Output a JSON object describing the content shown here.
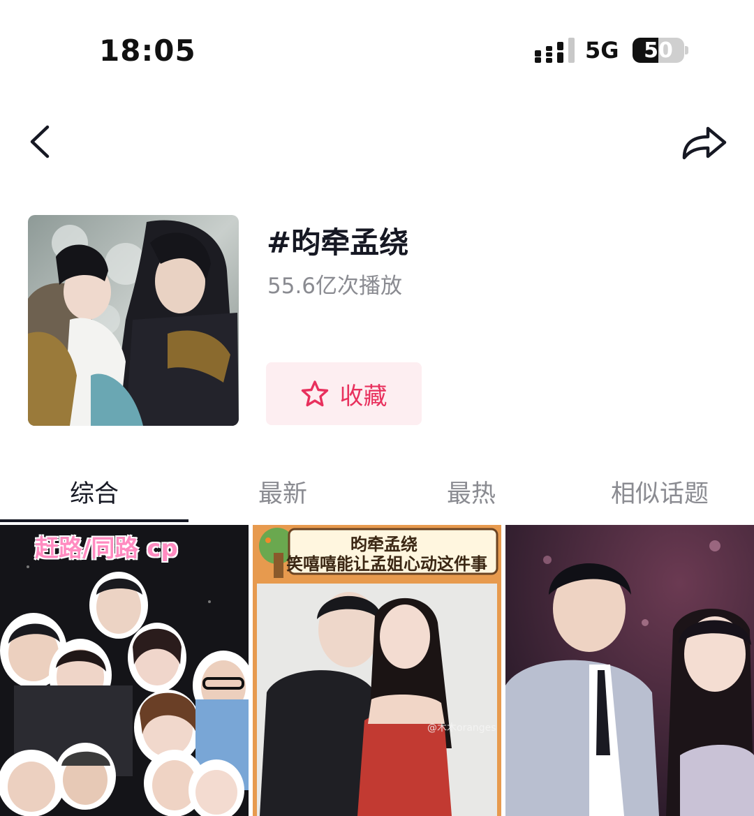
{
  "status_bar": {
    "time": "18:05",
    "network": "5G",
    "battery": "50",
    "battery_level": 0.5
  },
  "nav": {
    "back_icon": "chevron-left-icon",
    "share_icon": "share-arrow-icon"
  },
  "topic": {
    "title": "#昀牵孟绕",
    "play_count": "55.6亿次播放",
    "favorite_label": "收藏",
    "favorite_icon": "star-outline-icon"
  },
  "tabs": [
    {
      "label": "综合",
      "active": true
    },
    {
      "label": "最新",
      "active": false
    },
    {
      "label": "最热",
      "active": false
    },
    {
      "label": "相似话题",
      "active": false
    }
  ],
  "videos": [
    {
      "caption_top": "赶路/同路 cp"
    },
    {
      "caption_line1": "昀牵孟绕",
      "caption_line2": "笑嘻嘻能让孟姐心动这件事",
      "watermark": "@木木oranges"
    },
    {}
  ],
  "colors": {
    "accent": "#e8305d",
    "accent_bg": "#fdeef1",
    "text_primary": "#161823",
    "text_secondary": "#8a8b91"
  }
}
